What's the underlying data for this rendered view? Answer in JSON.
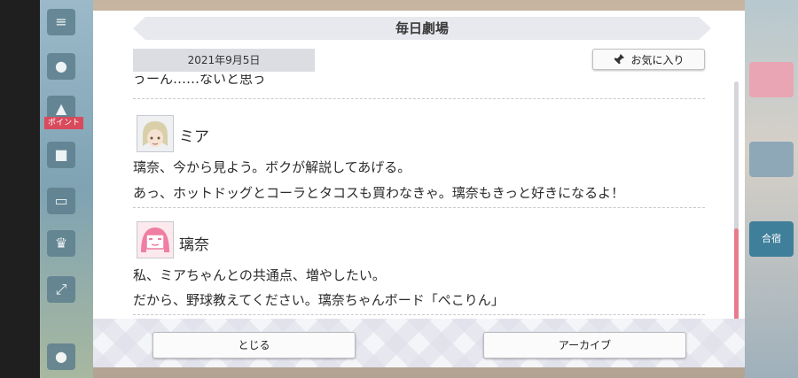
{
  "dialog": {
    "title": "毎日劇場",
    "date": "2021年9月5日",
    "favorite_label": "お気に入り",
    "scroll_progress": 0.62
  },
  "conversation": {
    "partial_line": "うーん……ないと思う",
    "entries": [
      {
        "speaker": "ミア",
        "lines": [
          "璃奈、今から見よう。ボクが解説してあげる。",
          "あっ、ホットドッグとコーラとタコスも買わなきゃ。璃奈もきっと好きになるよ！"
        ]
      },
      {
        "speaker": "璃奈",
        "lines": [
          "私、ミアちゃんとの共通点、増やしたい。",
          "だから、野球教えてください。璃奈ちゃんボード「ぺこりん」"
        ]
      }
    ]
  },
  "footer": {
    "close_label": "とじる",
    "archive_label": "アーカイブ"
  },
  "background": {
    "left_badge": "ポイント",
    "right_label": "合宿"
  },
  "colors": {
    "accent_pink": "#e87c8e",
    "title_bar": "#e8e9ee",
    "date_bg": "#dcdde3"
  }
}
